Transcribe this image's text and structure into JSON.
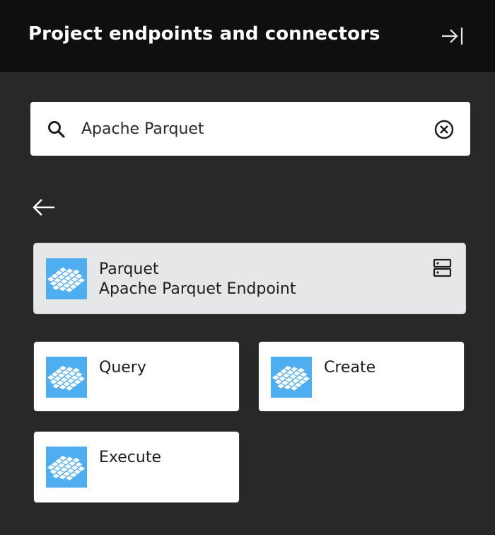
{
  "header": {
    "title": "Project endpoints and connectors",
    "collapse_icon": "panel-collapse-right-icon"
  },
  "search": {
    "value": "Apache Parquet",
    "placeholder": "Search",
    "search_icon": "search-icon",
    "clear_icon": "clear-circle-x-icon"
  },
  "navigation": {
    "back_icon": "arrow-left-icon"
  },
  "endpoint": {
    "name": "Parquet",
    "subtitle": "Apache Parquet Endpoint",
    "logo": "apache-parquet-logo",
    "type_icon": "server-endpoint-icon"
  },
  "operations": [
    {
      "label": "Query",
      "logo": "apache-parquet-logo"
    },
    {
      "label": "Create",
      "logo": "apache-parquet-logo"
    },
    {
      "label": "Execute",
      "logo": "apache-parquet-logo"
    }
  ],
  "colors": {
    "header_bg": "#0f0f0f",
    "panel_bg": "#272928",
    "logo_blue": "#4faef0",
    "selected_card_bg": "#e6e7e9"
  }
}
